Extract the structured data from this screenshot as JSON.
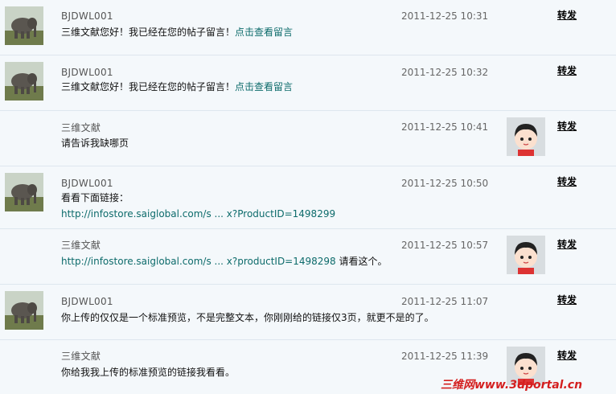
{
  "messages": [
    {
      "author": "BJDWL001",
      "time": "2011-12-25 10:31",
      "forward": "转发",
      "avatar": "elephant-avatar",
      "line1": {
        "text": "三维文献您好！我已经在您的帖子留言！",
        "link": "点击查看留言"
      }
    },
    {
      "author": "BJDWL001",
      "time": "2011-12-25 10:32",
      "forward": "转发",
      "avatar": "elephant-avatar",
      "line1": {
        "text": "三维文献您好！我已经在您的帖子留言！",
        "link": "点击查看留言"
      }
    },
    {
      "author": "三维文献",
      "time": "2011-12-25 10:41",
      "forward": "转发",
      "avatar": "cartoon-girl-avatar",
      "line1": {
        "text": "请告诉我缺哪页"
      }
    },
    {
      "author": "BJDWL001",
      "time": "2011-12-25 10:50",
      "forward": "转发",
      "avatar": "elephant-avatar",
      "line1": {
        "text": "看看下面链接："
      },
      "line2": {
        "link": "http://infostore.saiglobal.com/s ... x?ProductID=1498299"
      }
    },
    {
      "author": "三维文献",
      "time": "2011-12-25 10:57",
      "forward": "转发",
      "avatar": "cartoon-girl-avatar",
      "line1": {
        "link": "http://infostore.saiglobal.com/s ... x?productID=1498298",
        "text": " 请看这个。"
      }
    },
    {
      "author": "BJDWL001",
      "time": "2011-12-25 11:07",
      "forward": "转发",
      "avatar": "elephant-avatar",
      "line1": {
        "text": "你上传的仅仅是一个标准预览，不是完整文本，你刚刚给的链接仅3页，就更不是的了。"
      }
    },
    {
      "author": "三维文献",
      "time": "2011-12-25 11:39",
      "forward": "转发",
      "avatar": "cartoon-girl-avatar",
      "line1": {
        "text": "你给我我上传的标准预览的链接我看看。"
      }
    }
  ],
  "watermark": "三维网www.3dportal.cn",
  "colors": {
    "link": "#0d6b6b",
    "background": "#f4f8fb",
    "watermark": "#d41f1f"
  }
}
